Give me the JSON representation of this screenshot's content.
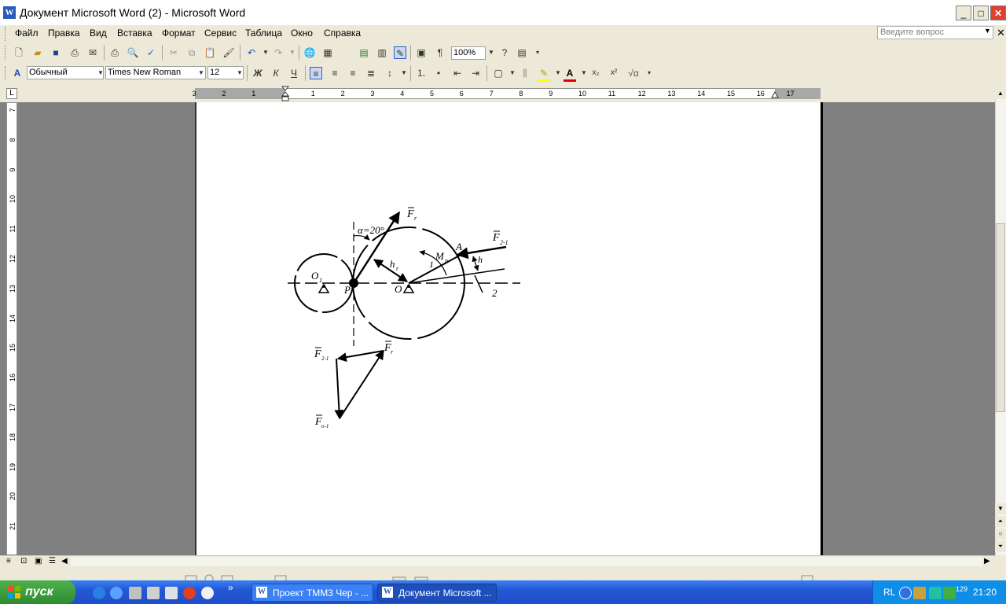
{
  "window": {
    "title": "Документ Microsoft Word (2) - Microsoft Word",
    "app_icon": "W",
    "minimize": "_",
    "maximize": "□",
    "close": "✕"
  },
  "menu": {
    "items": [
      "Файл",
      "Правка",
      "Вид",
      "Вставка",
      "Формат",
      "Сервис",
      "Таблица",
      "Окно",
      "Справка"
    ],
    "ask_placeholder": "Введите вопрос",
    "doc_close": "✕"
  },
  "toolbar": {
    "zoom": "100%",
    "style": "Обычный",
    "font": "Times New Roman",
    "size": "12",
    "bold": "Ж",
    "italic": "К",
    "underline": "Ч"
  },
  "ruler": {
    "h_labels": [
      "3",
      "2",
      "1",
      "1",
      "2",
      "3",
      "4",
      "5",
      "6",
      "7",
      "8",
      "9",
      "10",
      "11",
      "12",
      "13",
      "14",
      "15",
      "16",
      "17"
    ],
    "v_labels": [
      "7",
      "8",
      "9",
      "10",
      "11",
      "12",
      "13",
      "14",
      "15",
      "16",
      "17",
      "18",
      "19",
      "20",
      "21"
    ],
    "corner": "L"
  },
  "drawing": {
    "label_alpha": "α=20°",
    "label_Fr": "F",
    "label_Fr_sub": "r",
    "label_F21": "F",
    "label_F21_sub": "2-1",
    "label_A": "A",
    "label_Mn": "M",
    "label_Mn_sub": "п",
    "label_h": "h",
    "label_hr": "h",
    "label_hr_sub": "r",
    "label_O1": "O",
    "label_O1_sub": "1",
    "label_P": "P",
    "label_O": "O",
    "label_1": "1",
    "label_2": "2",
    "label_F21b": "F",
    "label_F21b_sub": "2-1",
    "label_Frb": "F",
    "label_Frb_sub": "r",
    "label_Fo1": "F",
    "label_Fo1_sub": "o-1"
  },
  "taskbar": {
    "start": "пуск",
    "tasks": [
      "Проект ТММ3 Чер - ...",
      "Документ Microsoft ..."
    ],
    "lang": "RL",
    "clock": "21:20",
    "tray_number": "129"
  }
}
